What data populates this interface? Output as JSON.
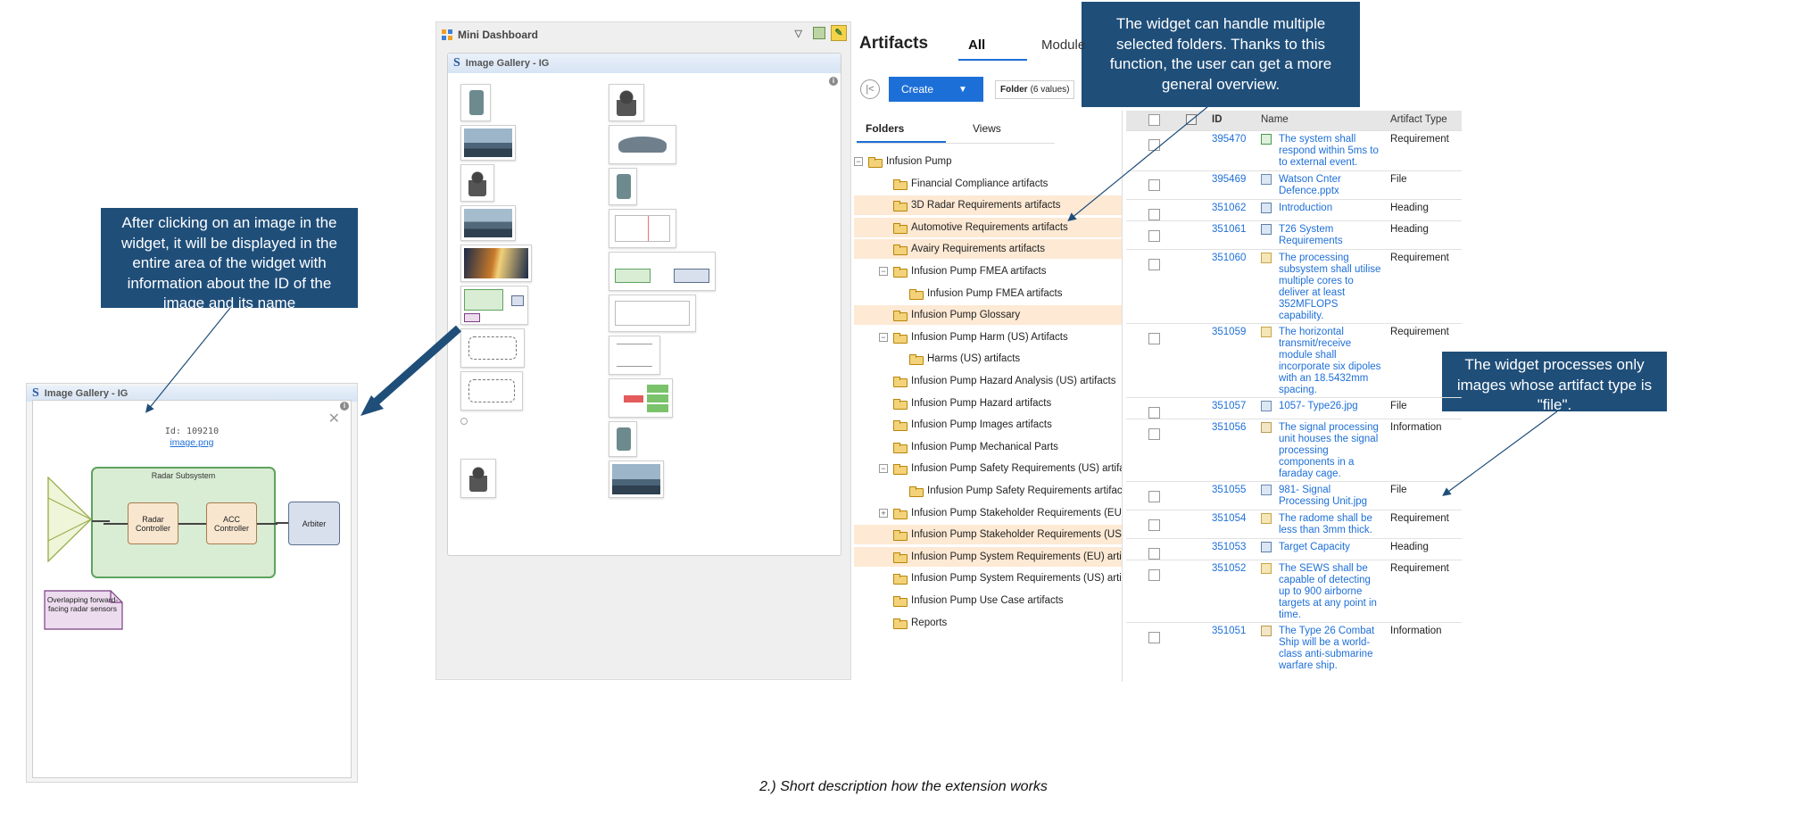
{
  "callouts": {
    "left": "After clicking on an image in the widget, it will be displayed in the entire area of the widget with information about the ID of the image and its name",
    "top": "The widget can handle multiple selected folders. Thanks to this function, the user can get a more general overview.",
    "right": "The widget processes only images whose artifact type is \"file\"."
  },
  "caption": "2.) Short description how the extension works",
  "detail_widget": {
    "title": "Image Gallery - IG",
    "image_id": "Id: 109210",
    "image_name": "image.png",
    "diagram": {
      "subsystem": "Radar Subsystem",
      "radar_controller": "Radar Controller",
      "acc_controller": "ACC Controller",
      "arbiter": "Arbiter",
      "note": "Overlapping forward-facing radar sensors"
    }
  },
  "dashboard": {
    "title": "Mini Dashboard",
    "gallery_title": "Image Gallery - IG"
  },
  "artifacts": {
    "title": "Artifacts",
    "tabs": [
      "All",
      "Module"
    ],
    "create_label": "Create",
    "folder_filter_label": "Folder",
    "folder_filter_count": "(6 values)",
    "side_tabs": [
      "Folders",
      "Views"
    ],
    "folders": [
      {
        "label": "Infusion Pump",
        "level": 0,
        "expand": "−",
        "hl": false
      },
      {
        "label": "Financial Compliance artifacts",
        "level": 1,
        "hl": false
      },
      {
        "label": "3D Radar Requirements artifacts",
        "level": 1,
        "hl": true
      },
      {
        "label": "Automotive Requirements artifacts",
        "level": 1,
        "hl": true
      },
      {
        "label": "Avairy Requirements artifacts",
        "level": 1,
        "hl": true
      },
      {
        "label": "Infusion Pump FMEA artifacts",
        "level": 1,
        "expand": "−",
        "hl": false
      },
      {
        "label": "Infusion Pump FMEA artifacts",
        "level": 2,
        "hl": false
      },
      {
        "label": "Infusion Pump Glossary",
        "level": 1,
        "hl": true
      },
      {
        "label": "Infusion Pump Harm (US) Artifacts",
        "level": 1,
        "expand": "−",
        "hl": false
      },
      {
        "label": "Harms (US) artifacts",
        "level": 2,
        "hl": false
      },
      {
        "label": "Infusion Pump Hazard Analysis (US) artifacts",
        "level": 1,
        "hl": false
      },
      {
        "label": "Infusion Pump Hazard artifacts",
        "level": 1,
        "hl": false
      },
      {
        "label": "Infusion Pump Images artifacts",
        "level": 1,
        "hl": false
      },
      {
        "label": "Infusion Pump Mechanical Parts",
        "level": 1,
        "hl": false
      },
      {
        "label": "Infusion Pump Safety Requirements (US) artifacts",
        "level": 1,
        "expand": "−",
        "hl": false
      },
      {
        "label": "Infusion Pump Safety Requirements artifacts",
        "level": 2,
        "hl": false
      },
      {
        "label": "Infusion Pump Stakeholder Requirements (EU) artifacts",
        "level": 1,
        "expand": "+",
        "hl": false
      },
      {
        "label": "Infusion Pump Stakeholder Requirements (US) artifacts",
        "level": 1,
        "hl": true
      },
      {
        "label": "Infusion Pump System Requirements (EU) artifacts",
        "level": 1,
        "hl": true
      },
      {
        "label": "Infusion Pump System Requirements (US) artifacts",
        "level": 1,
        "hl": false
      },
      {
        "label": "Infusion Pump Use Case artifacts",
        "level": 1,
        "hl": false
      },
      {
        "label": "Reports",
        "level": 1,
        "hl": false
      }
    ],
    "columns": [
      "ID",
      "Name",
      "Artifact Type"
    ],
    "rows": [
      {
        "id": "395470",
        "name": "The system shall respond within 5ms to to external event.",
        "type": "Requirement",
        "icon": "watch"
      },
      {
        "id": "395469",
        "name": "Watson Cnter Defence.pptx",
        "type": "File",
        "icon": "file"
      },
      {
        "id": "351062",
        "name": "Introduction",
        "type": "Heading",
        "icon": "head"
      },
      {
        "id": "351061",
        "name": "T26 System Requirements",
        "type": "Heading",
        "icon": "head"
      },
      {
        "id": "351060",
        "name": "The processing subsystem shall utilise multiple cores to deliver at least 352MFLOPS capability.",
        "type": "Requirement",
        "icon": "req"
      },
      {
        "id": "351059",
        "name": "The horizontal transmit/receive module shall incorporate six dipoles with an 18.5432mm spacing.",
        "type": "Requirement",
        "icon": "req"
      },
      {
        "id": "351057",
        "name": "1057- Type26.jpg",
        "type": "File",
        "icon": "file"
      },
      {
        "id": "351056",
        "name": "The signal processing unit houses the signal processing components in a faraday cage.",
        "type": "Information",
        "icon": "info"
      },
      {
        "id": "351055",
        "name": "981- Signal Processing Unit.jpg",
        "type": "File",
        "icon": "file"
      },
      {
        "id": "351054",
        "name": "The radome shall be less than 3mm thick.",
        "type": "Requirement",
        "icon": "req"
      },
      {
        "id": "351053",
        "name": "Target Capacity",
        "type": "Heading",
        "icon": "head"
      },
      {
        "id": "351052",
        "name": "The SEWS shall be capable of detecting up to 900 airborne targets at any point in time.",
        "type": "Requirement",
        "icon": "req"
      },
      {
        "id": "351051",
        "name": "The Type 26 Combat Ship will be a world-class anti-submarine warfare ship.",
        "type": "Information",
        "icon": "info"
      }
    ]
  },
  "colors": {
    "callout": "#1f4e79",
    "accent": "#1d6fd8",
    "highlight": "#fde9d4"
  }
}
